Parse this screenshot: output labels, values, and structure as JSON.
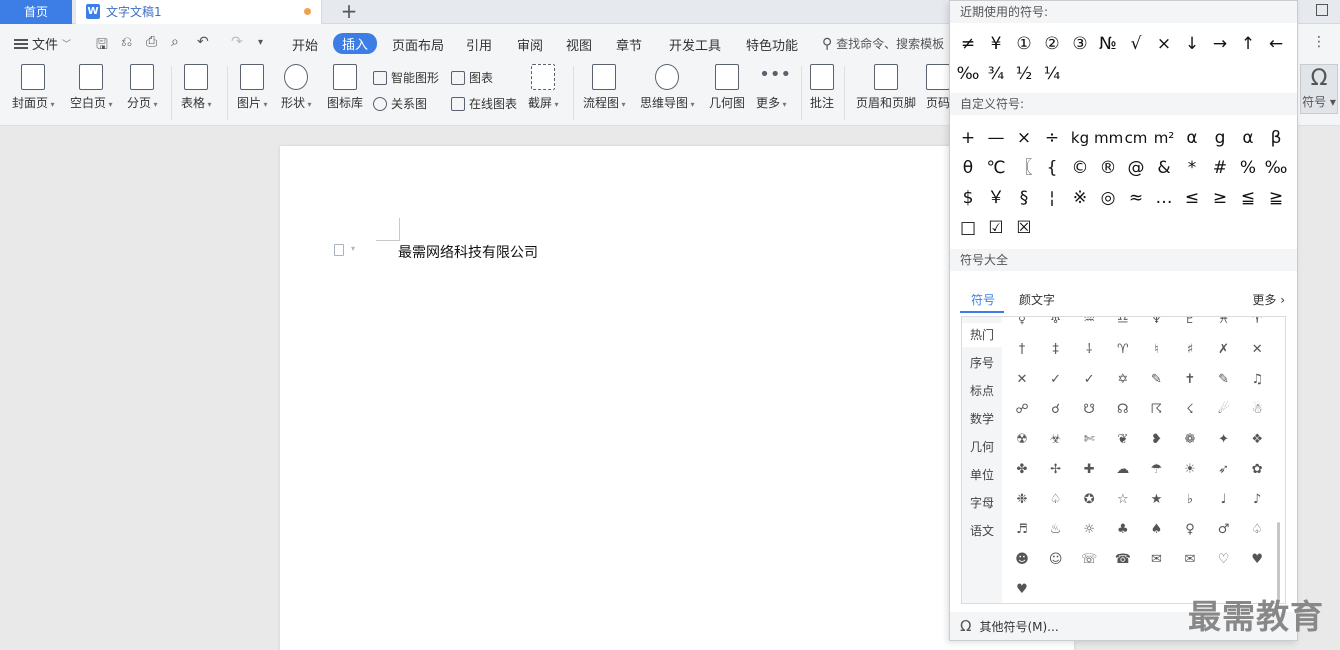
{
  "tabs": {
    "home": "首页",
    "doc_title": "文字文稿1",
    "add": "+"
  },
  "menu": {
    "file": "文件",
    "items": [
      "开始",
      "插入",
      "页面布局",
      "引用",
      "审阅",
      "视图",
      "章节",
      "开发工具",
      "特色功能"
    ],
    "active": "插入",
    "search": "查找命令、搜索模板"
  },
  "ribbon": {
    "cover": "封面页",
    "blank": "空白页",
    "pagebreak": "分页",
    "table": "表格",
    "picture": "图片",
    "shape": "形状",
    "iconlib": "图标库",
    "smartart": "智能图形",
    "chart": "图表",
    "relation": "关系图",
    "online_chart": "在线图表",
    "screenshot": "截屏",
    "flowchart": "流程图",
    "mindmap": "思维导图",
    "geometry": "几何图",
    "more": "更多",
    "comment": "批注",
    "header_footer": "页眉和页脚",
    "pagenum": "页码",
    "symbol": "符号"
  },
  "document": {
    "text": "最需网络科技有限公司"
  },
  "panel": {
    "recent_title": "近期使用的符号:",
    "recent": [
      "≠",
      "¥",
      "①",
      "②",
      "③",
      "№",
      "√",
      "×",
      "↓",
      "→",
      "↑",
      "←",
      "‰",
      "¾",
      "½",
      "¼"
    ],
    "custom_title": "自定义符号:",
    "custom": [
      "+",
      "—",
      "×",
      "÷",
      "kg",
      "mm",
      "cm",
      "m²",
      "α",
      "g",
      "α",
      "β",
      "θ",
      "℃",
      "〖",
      "{",
      "©",
      "®",
      "@",
      "&",
      "*",
      "#",
      "%",
      "‰",
      "$",
      "￥",
      "§",
      "¦",
      "※",
      "◎",
      "≈",
      "…",
      "≤",
      "≥",
      "≦",
      "≧",
      "□",
      "☑",
      "☒"
    ],
    "all_title": "符号大全",
    "tab_symbols": "符号",
    "tab_kaomoji": "颜文字",
    "more": "更多",
    "categories": [
      "热门",
      "序号",
      "标点",
      "数学",
      "几何",
      "单位",
      "字母",
      "语文"
    ],
    "grid": [
      "☿",
      "♅",
      "♒",
      "♎",
      "♆",
      "♇",
      "♓",
      "♈",
      "†",
      "‡",
      "⸸",
      "♈",
      "♮",
      "♯",
      "✗",
      "✕",
      "✕",
      "✓",
      "✓",
      "✡",
      "✎",
      "✝",
      "✎",
      "♫",
      "☍",
      "☌",
      "☋",
      "☊",
      "☈",
      "☇",
      "☄",
      "☃",
      "☢",
      "☣",
      "✄",
      "❦",
      "❥",
      "❁",
      "✦",
      "❖",
      "✤",
      "✢",
      "✚",
      "☁",
      "☂",
      "☀",
      "➶",
      "✿",
      "❉",
      "♤",
      "✪",
      "☆",
      "★",
      "♭",
      "♩",
      "♪",
      "♬",
      "♨",
      "☼",
      "♣",
      "♠",
      "♀",
      "♂",
      "♤",
      "☻",
      "☺",
      "☏",
      "☎",
      "✉",
      "✉",
      "♡",
      "♥",
      "♥"
    ],
    "footer": "其他符号(M)..."
  },
  "watermark": "最需教育"
}
